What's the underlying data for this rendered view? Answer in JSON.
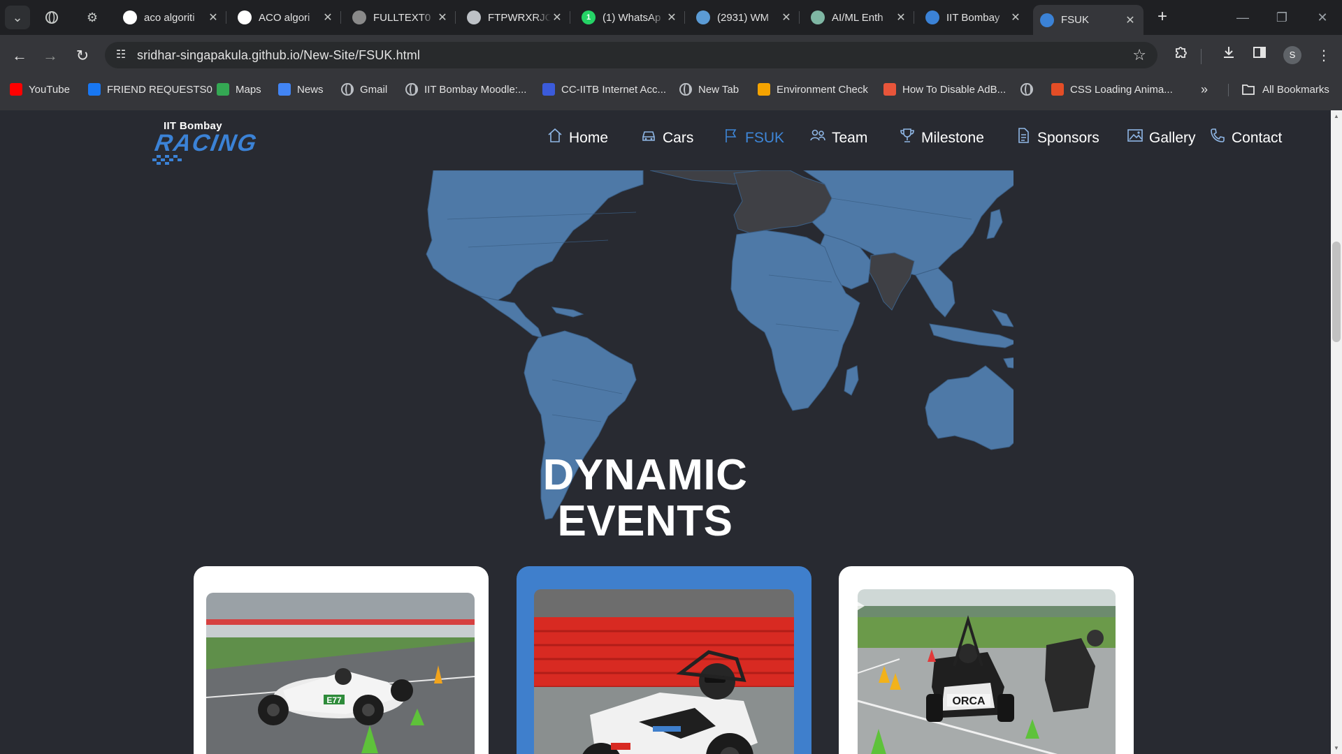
{
  "browser": {
    "tabs": [
      {
        "title": "aco algoriti",
        "icon": "google-icon",
        "color": "#ffffff"
      },
      {
        "title": "ACO algori",
        "icon": "researchgate-icon",
        "color": "#ffffff"
      },
      {
        "title": "FULLTEXT0",
        "icon": "document-icon",
        "color": "#8a8a8a"
      },
      {
        "title": "FTPWRXRJC",
        "icon": "globe-icon",
        "color": "#bdc1c6"
      },
      {
        "title": "(1) WhatsAp",
        "icon": "whatsapp-icon",
        "color": "#25d366",
        "badge": "1"
      },
      {
        "title": "(2931) WM",
        "icon": "wm-icon",
        "color": "#5b9bd5"
      },
      {
        "title": "AI/ML Enth",
        "icon": "chatgpt-icon",
        "color": "#7fb7a4"
      },
      {
        "title": "IIT Bombay",
        "icon": "iitb-racing-icon",
        "color": "#3b82d6"
      },
      {
        "title": "FSUK",
        "icon": "iitb-racing-icon",
        "color": "#3b82d6",
        "active": true
      }
    ],
    "url": "sridhar-singapakula.github.io/New-Site/FSUK.html",
    "profile_initial": "S",
    "bookmarks": [
      {
        "label": "YouTube",
        "icon": "youtube-icon",
        "color": "#ff0000"
      },
      {
        "label": "FRIEND REQUESTS0",
        "icon": "facebook-icon",
        "color": "#1877f2"
      },
      {
        "label": "Maps",
        "icon": "maps-icon",
        "color": "#34a853"
      },
      {
        "label": "News",
        "icon": "news-icon",
        "color": "#4285f4"
      },
      {
        "label": "Gmail",
        "icon": "globe-icon"
      },
      {
        "label": "IIT Bombay Moodle:...",
        "icon": "globe-icon"
      },
      {
        "label": "CC-IITB Internet Acc...",
        "icon": "bank-icon",
        "color": "#3b5bdb"
      },
      {
        "label": "New Tab",
        "icon": "globe-icon"
      },
      {
        "label": "Environment Check",
        "icon": "sun-icon",
        "color": "#f4a300"
      },
      {
        "label": "How To Disable AdB...",
        "icon": "rocket-icon",
        "color": "#e8553a"
      },
      {
        "label": "",
        "icon": "settings-globe-icon"
      },
      {
        "label": "CSS Loading Anima...",
        "icon": "css-icon",
        "color": "#e44d26"
      }
    ],
    "all_bookmarks": "All Bookmarks"
  },
  "site": {
    "logo_line1": "IIT Bombay",
    "logo_line2": "RACING",
    "nav": [
      {
        "label": "Home",
        "icon": "home-icon"
      },
      {
        "label": "Cars",
        "icon": "car-icon"
      },
      {
        "label": "FSUK",
        "icon": "flag-icon",
        "active": true
      },
      {
        "label": "Team",
        "icon": "team-icon"
      },
      {
        "label": "Milestone",
        "icon": "trophy-icon"
      },
      {
        "label": "Sponsors",
        "icon": "document-icon"
      },
      {
        "label": "Gallery",
        "icon": "image-icon"
      },
      {
        "label": "Contact",
        "icon": "phone-icon"
      }
    ],
    "section_title_line1": "DYNAMIC",
    "section_title_line2": "EVENTS",
    "cards": [
      {
        "image": "white-race-car-on-track",
        "car_number": "E77",
        "highlighted": false
      },
      {
        "image": "race-car-closeup-red-barrier",
        "highlighted": true
      },
      {
        "image": "orca-car-autocross-cones",
        "car_text": "ORCA",
        "highlighted": false
      }
    ],
    "colors": {
      "background": "#282a31",
      "accent": "#3e86d8",
      "map_land": "#4e79a7",
      "map_highlight": "#3f4045"
    }
  }
}
